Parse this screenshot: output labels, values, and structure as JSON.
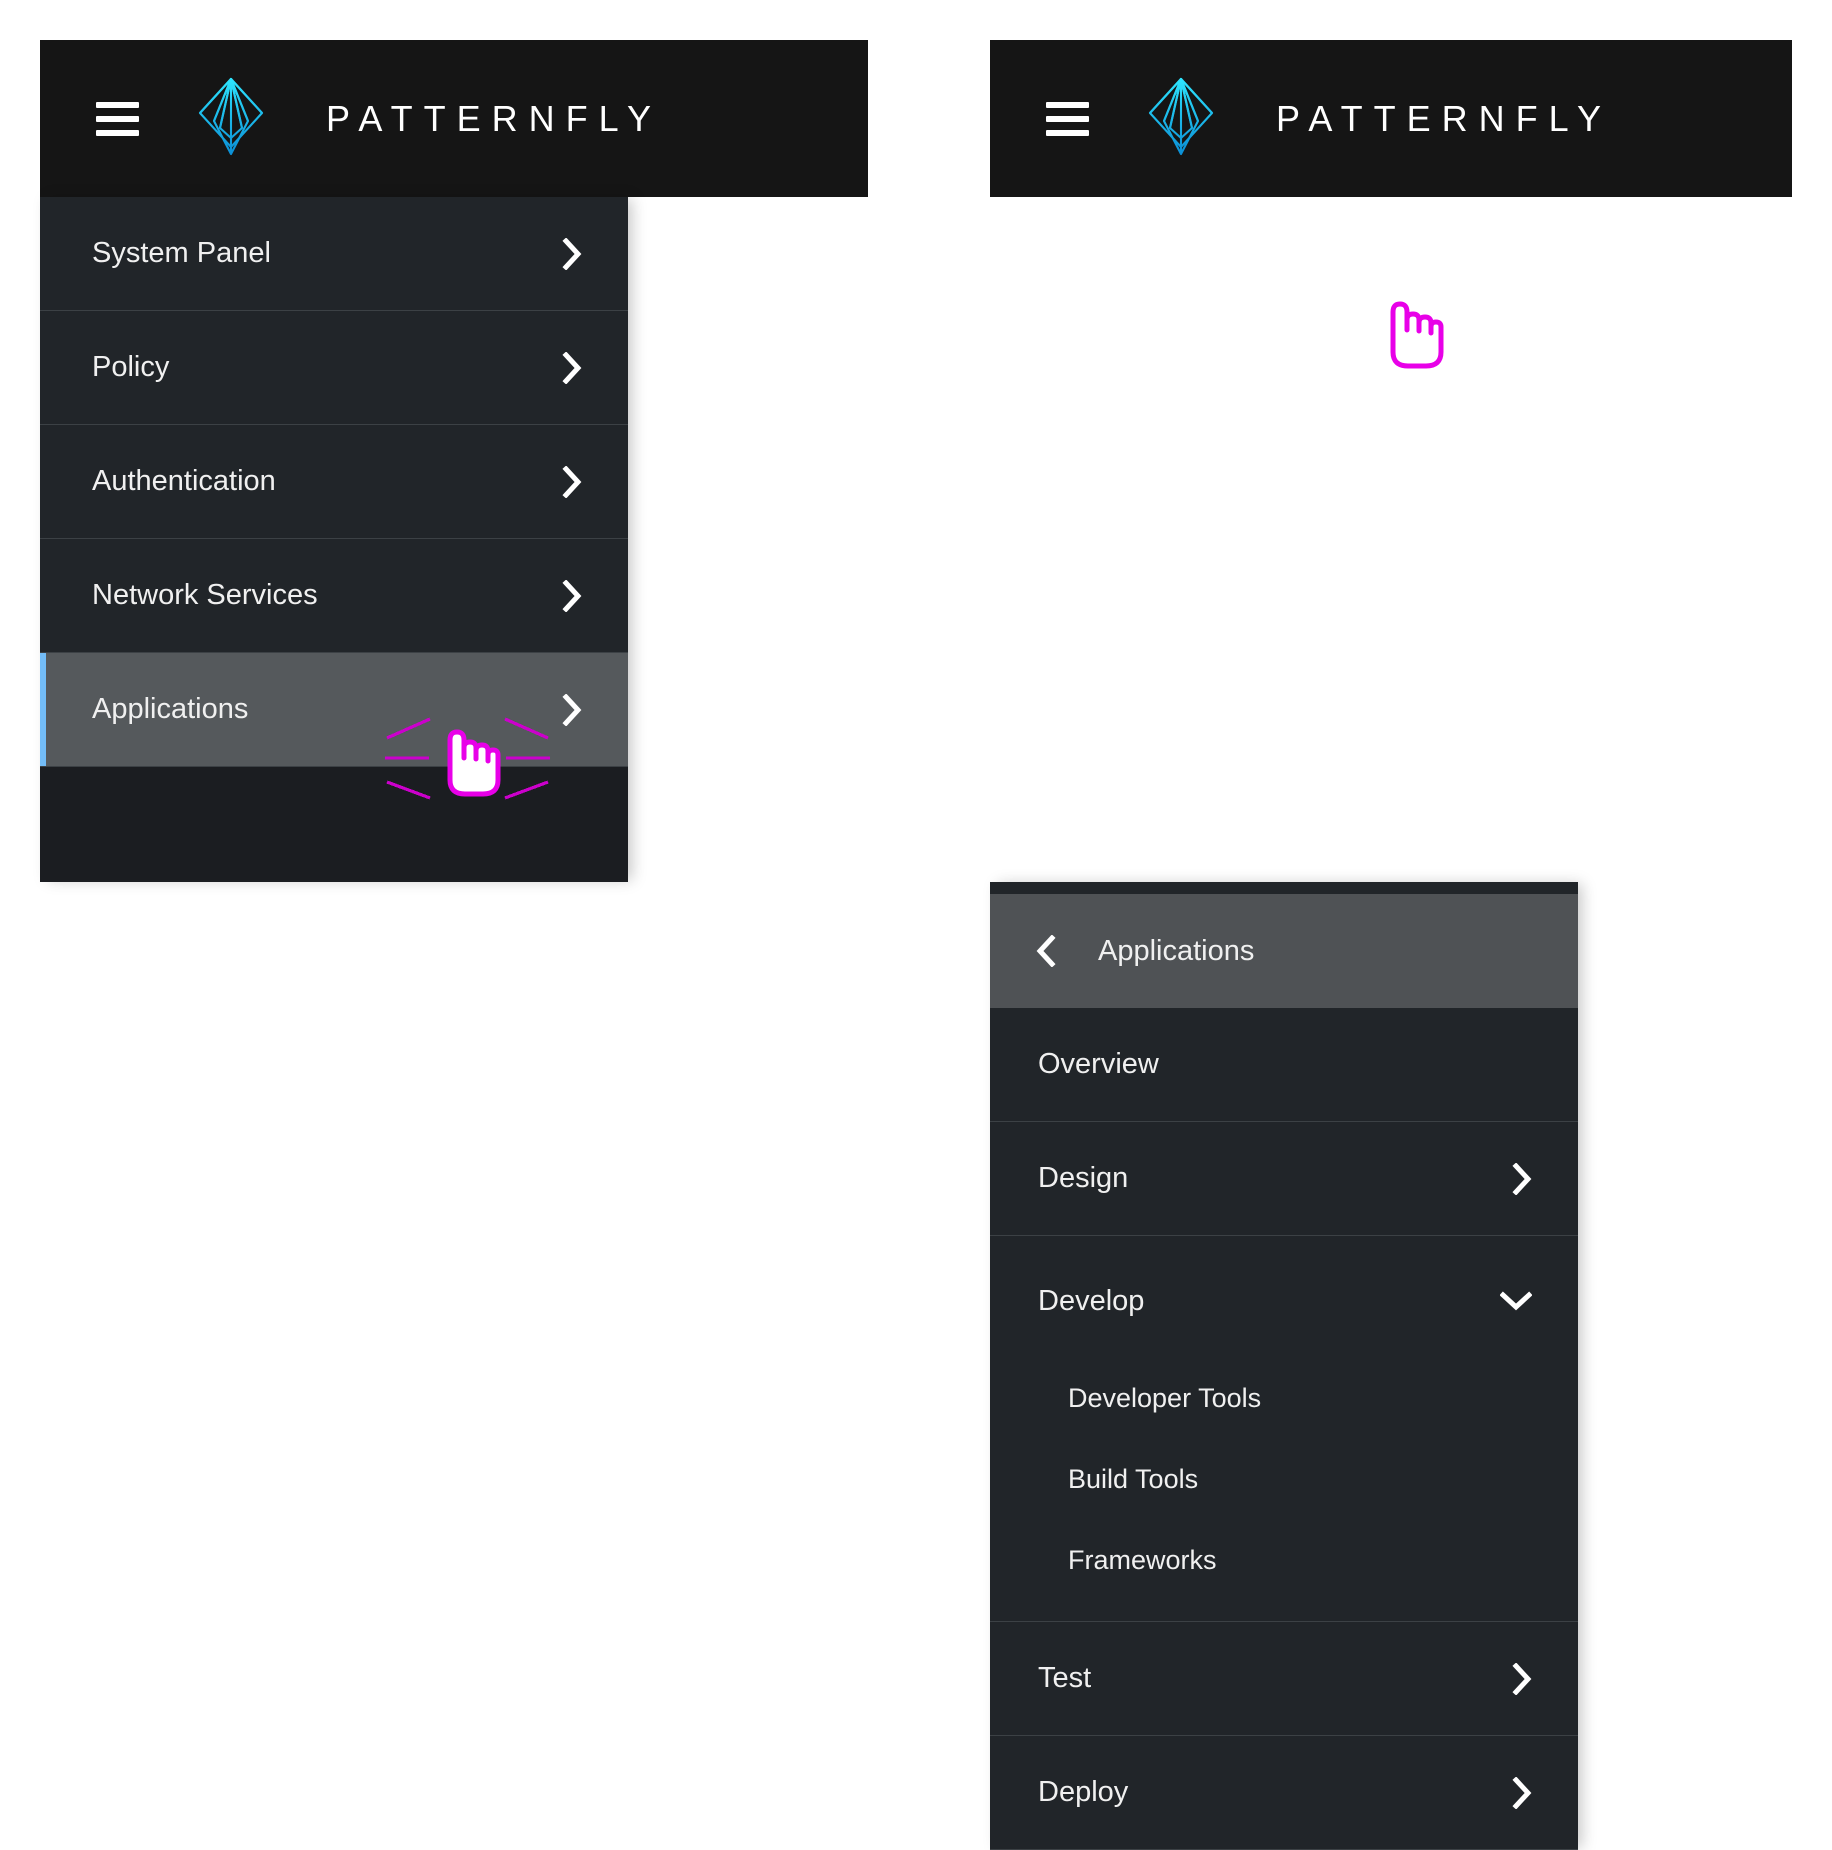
{
  "brand": {
    "name": "PATTERNFLY",
    "logo_icon": "patternfly-diamond-logo",
    "logo_color": "#2bc4f5",
    "menu_icon": "hamburger-menu-icon"
  },
  "colors": {
    "masthead_bg": "#151515",
    "nav_bg": "#212529",
    "nav_divider": "#3c4145",
    "nav_current_bg": "#4f5255",
    "nav_current_left_bg": "#55595c",
    "accent_bar": "#73bcf7",
    "text": "#f0f0f0",
    "cursor_highlight": "#e318d4"
  },
  "left_panel": {
    "label": "Primary navigation drawer",
    "items": [
      {
        "label": "System Panel",
        "chevron": "chevron-right-icon",
        "state": "default"
      },
      {
        "label": "Policy",
        "chevron": "chevron-right-icon",
        "state": "default"
      },
      {
        "label": "Authentication",
        "chevron": "chevron-right-icon",
        "state": "default"
      },
      {
        "label": "Network Services",
        "chevron": "chevron-right-icon",
        "state": "default"
      },
      {
        "label": "Applications",
        "chevron": "chevron-right-icon",
        "state": "current"
      }
    ],
    "cursor": {
      "icon": "pointing-hand-cursor",
      "effect": "click-burst"
    }
  },
  "right_panel": {
    "label": "Applications subnavigation drawer",
    "back_item": {
      "label": "Applications",
      "chevron": "chevron-left-icon",
      "state": "current"
    },
    "items": [
      {
        "label": "Overview",
        "chevron": "",
        "state": "default"
      },
      {
        "label": "Design",
        "chevron": "chevron-right-icon",
        "state": "default"
      },
      {
        "label": "Develop",
        "chevron": "chevron-down-icon",
        "state": "expanded"
      },
      {
        "label": "Test",
        "chevron": "chevron-right-icon",
        "state": "default"
      },
      {
        "label": "Deploy",
        "chevron": "chevron-right-icon",
        "state": "default"
      }
    ],
    "develop_subitems": [
      {
        "label": "Developer Tools"
      },
      {
        "label": "Build Tools"
      },
      {
        "label": "Frameworks"
      }
    ],
    "cursor": {
      "icon": "pointing-hand-cursor",
      "effect": "none"
    }
  }
}
